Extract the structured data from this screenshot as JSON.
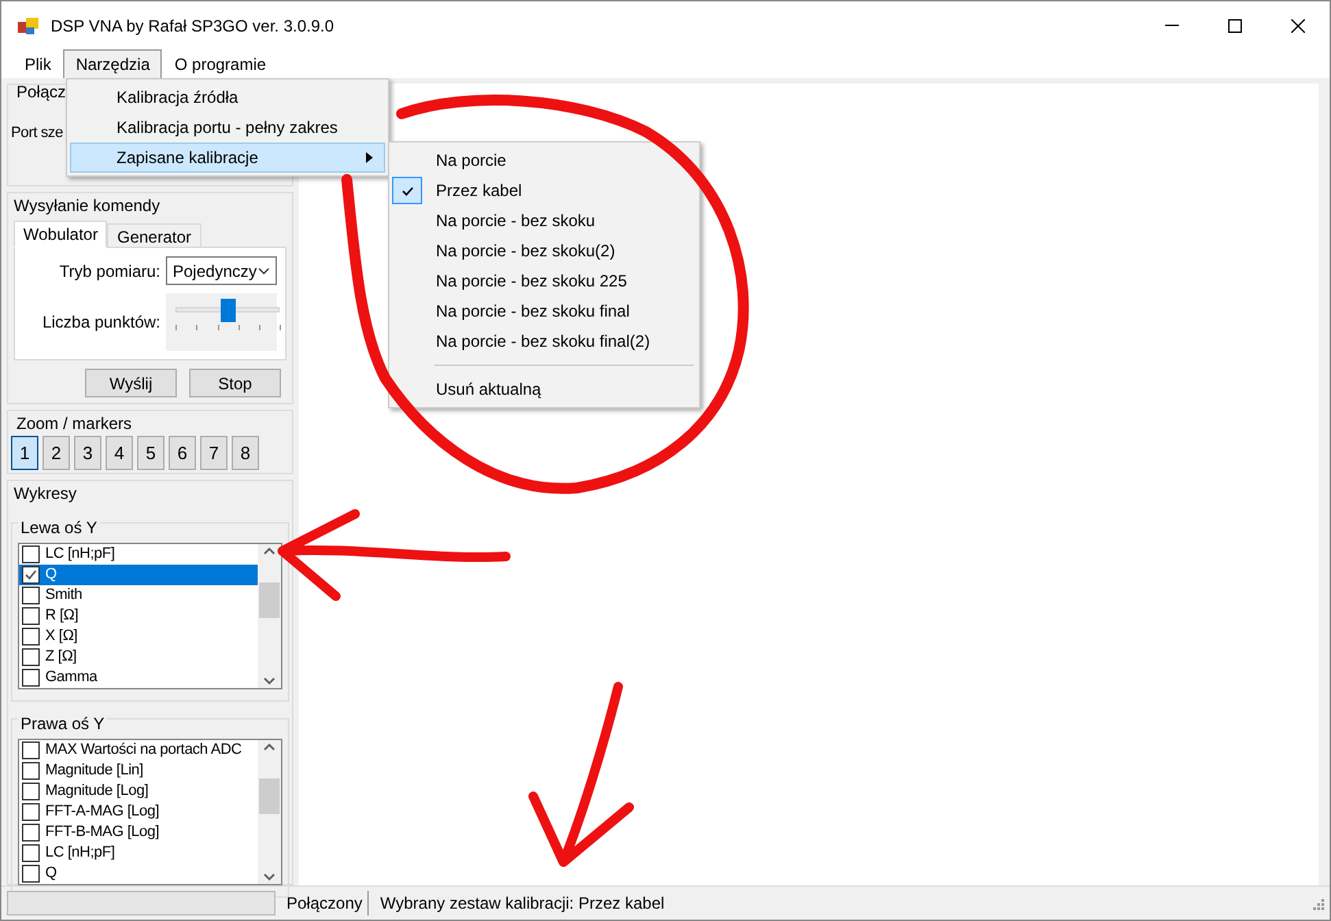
{
  "window": {
    "title": "DSP VNA by Rafał SP3GO ver. 3.0.9.0"
  },
  "menu_bar": [
    {
      "label": "Plik",
      "selected": false
    },
    {
      "label": "Narzędzia",
      "selected": true
    },
    {
      "label": "O programie",
      "selected": false
    }
  ],
  "open_menu": [
    {
      "label": "Kalibracja źródła",
      "kind": "item",
      "selected": false
    },
    {
      "label": "Kalibracja portu - pełny zakres",
      "kind": "item",
      "selected": false
    },
    {
      "label": "Zapisane kalibracje",
      "kind": "submenu",
      "selected": true
    }
  ],
  "submenu": {
    "items": [
      {
        "label": "Na porcie",
        "checked": false
      },
      {
        "label": "Przez kabel",
        "checked": true
      },
      {
        "label": "Na porcie - bez skoku",
        "checked": false
      },
      {
        "label": "Na porcie - bez skoku(2)",
        "checked": false
      },
      {
        "label": "Na porcie - bez skoku 225",
        "checked": false
      },
      {
        "label": "Na porcie - bez skoku final",
        "checked": false
      },
      {
        "label": "Na porcie - bez skoku final(2)",
        "checked": false
      }
    ],
    "footer_item": "Usuń aktualną"
  },
  "connection_group": {
    "title": "Połącz",
    "port_label": "Port sze"
  },
  "command_group": {
    "title": "Wysyłanie komendy",
    "tabs": [
      {
        "label": "Wobulator",
        "selected": true
      },
      {
        "label": "Generator",
        "selected": false
      }
    ],
    "mode_label": "Tryb pomiaru:",
    "mode_value": "Pojedynczy",
    "points_label": "Liczba punktów:",
    "points_slider": {
      "level": 0.5
    },
    "buttons": [
      "Wyślij",
      "Stop"
    ]
  },
  "zoom_group": {
    "title": "Zoom / markers",
    "buttons": [
      {
        "label": "1",
        "selected": true
      },
      {
        "label": "2",
        "selected": false
      },
      {
        "label": "3",
        "selected": false
      },
      {
        "label": "4",
        "selected": false
      },
      {
        "label": "5",
        "selected": false
      },
      {
        "label": "6",
        "selected": false
      },
      {
        "label": "7",
        "selected": false
      },
      {
        "label": "8",
        "selected": false
      }
    ]
  },
  "charts_group": {
    "title": "Wykresy",
    "left_axis": {
      "title": "Lewa oś Y",
      "items": [
        {
          "label": "LC [nH;pF]",
          "checked": false,
          "selected": false
        },
        {
          "label": "Q",
          "checked": true,
          "selected": true
        },
        {
          "label": "Smith",
          "checked": false,
          "selected": false
        },
        {
          "label": "R [Ω]",
          "checked": false,
          "selected": false
        },
        {
          "label": "X [Ω]",
          "checked": false,
          "selected": false
        },
        {
          "label": "Z [Ω]",
          "checked": false,
          "selected": false
        },
        {
          "label": "Gamma",
          "checked": false,
          "selected": false
        }
      ]
    },
    "right_axis": {
      "title": "Prawa oś Y",
      "items": [
        {
          "label": "MAX Wartości na portach ADC",
          "checked": false,
          "selected": false
        },
        {
          "label": "Magnitude [Lin]",
          "checked": false,
          "selected": false
        },
        {
          "label": "Magnitude [Log]",
          "checked": false,
          "selected": false
        },
        {
          "label": "FFT-A-MAG [Log]",
          "checked": false,
          "selected": false
        },
        {
          "label": "FFT-B-MAG [Log]",
          "checked": false,
          "selected": false
        },
        {
          "label": "LC [nH;pF]",
          "checked": false,
          "selected": false
        },
        {
          "label": "Q",
          "checked": false,
          "selected": false
        }
      ]
    }
  },
  "status_bar": {
    "progress": {
      "level": 0
    },
    "connection": "Połączony",
    "message": "Wybrany zestaw kalibracji: Przez kabel"
  }
}
